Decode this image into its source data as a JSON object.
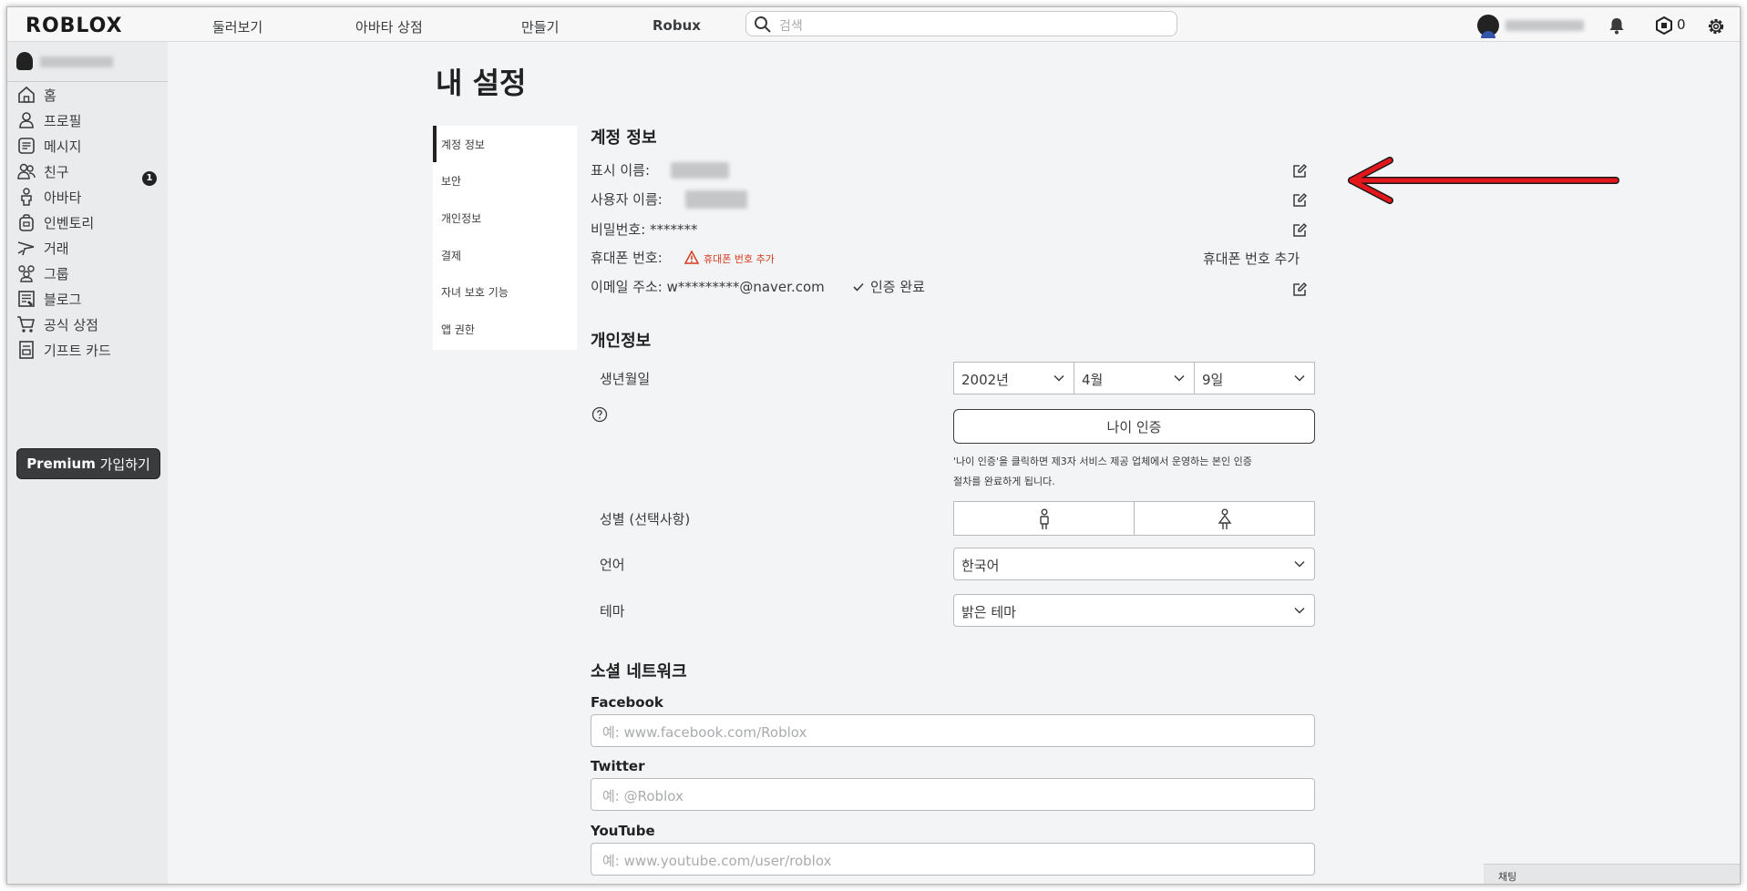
{
  "brand": {
    "logo": "ROBLOX"
  },
  "topnav": {
    "items": [
      "둘러보기",
      "아바타 상점",
      "만들기",
      "Robux"
    ]
  },
  "search": {
    "placeholder": "검색"
  },
  "header_right": {
    "robux_count": "0"
  },
  "sidebar": {
    "items": [
      {
        "label": "홈",
        "icon": "home-icon"
      },
      {
        "label": "프로필",
        "icon": "profile-icon"
      },
      {
        "label": "메시지",
        "icon": "messages-icon"
      },
      {
        "label": "친구",
        "icon": "friends-icon"
      },
      {
        "label": "아바타",
        "icon": "avatar-icon"
      },
      {
        "label": "인벤토리",
        "icon": "inventory-icon"
      },
      {
        "label": "거래",
        "icon": "trade-icon"
      },
      {
        "label": "그룹",
        "icon": "groups-icon"
      },
      {
        "label": "블로그",
        "icon": "blog-icon"
      },
      {
        "label": "공식 상점",
        "icon": "cart-icon"
      },
      {
        "label": "기프트 카드",
        "icon": "gift-card-icon"
      }
    ],
    "message_badge": "1",
    "premium_prefix": "Premium",
    "premium_suffix": " 가입하기"
  },
  "page": {
    "title": "내 설정"
  },
  "settings_nav": {
    "tabs": [
      "계정 정보",
      "보안",
      "개인정보",
      "결제",
      "자녀 보호 기능",
      "앱 권한"
    ],
    "active": "계정 정보"
  },
  "account": {
    "heading": "계정 정보",
    "display_name_label": "표시 이름:",
    "username_label": "사용자 이름:",
    "password_label": "비밀번호: *******",
    "phone_label": "휴대폰 번호:",
    "phone_warning": "휴대폰 번호 추가",
    "phone_add_link": "휴대폰 번호 추가",
    "email_label": "이메일 주소: w*********@naver.com",
    "email_verified": "인증 완료"
  },
  "personal": {
    "heading": "개인정보",
    "birthday_label": "생년월일",
    "birth_year": "2002년",
    "birth_month": "4월",
    "birth_day": "9일",
    "age_verify_button": "나이 인증",
    "age_note_line1": "'나이 인증'을 클릭하면 제3자 서비스 제공 업체에서 운영하는 본인 인증",
    "age_note_line2": "절차를 완료하게 됩니다.",
    "gender_label": "성별 (선택사항)",
    "language_label": "언어",
    "language_value": "한국어",
    "theme_label": "테마",
    "theme_value": "밝은 테마"
  },
  "social": {
    "heading": "소셜 네트워크",
    "facebook_label": "Facebook",
    "facebook_placeholder": "예: www.facebook.com/Roblox",
    "twitter_label": "Twitter",
    "twitter_placeholder": "예: @Roblox",
    "youtube_label": "YouTube",
    "youtube_placeholder": "예: www.youtube.com/user/roblox"
  },
  "chat": {
    "label": "채팅"
  },
  "colors": {
    "annotation_arrow": "#e3161c",
    "warning": "#d63a1f",
    "sidebar_bg": "#eaebec",
    "page_bg": "#f2f4f5"
  }
}
